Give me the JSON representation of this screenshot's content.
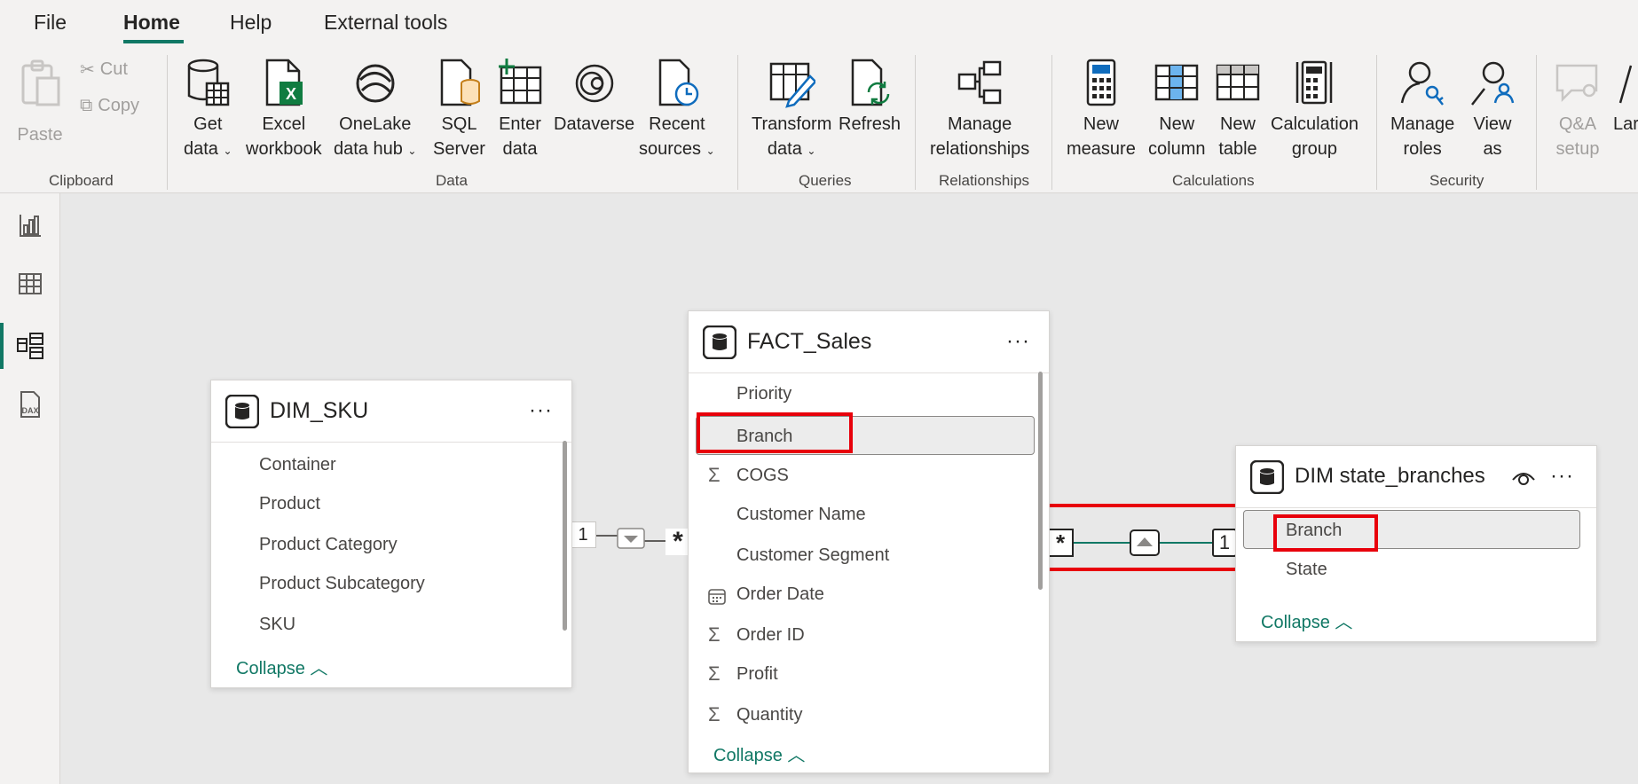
{
  "menu": {
    "tabs": [
      "File",
      "Home",
      "Help",
      "External tools"
    ],
    "active": "Home"
  },
  "ribbon": {
    "clipboard": {
      "paste": "Paste",
      "cut": "Cut",
      "copy": "Copy",
      "group": "Clipboard"
    },
    "data": {
      "get_data": [
        "Get",
        "data"
      ],
      "excel": [
        "Excel",
        "workbook"
      ],
      "onelake": [
        "OneLake",
        "data hub"
      ],
      "sql": [
        "SQL",
        "Server"
      ],
      "enter": [
        "Enter",
        "data"
      ],
      "dataverse": [
        "Dataverse"
      ],
      "recent": [
        "Recent",
        "sources"
      ],
      "group": "Data"
    },
    "queries": {
      "transform": [
        "Transform",
        "data"
      ],
      "refresh": [
        "Refresh"
      ],
      "group": "Queries"
    },
    "relationships": {
      "manage": [
        "Manage",
        "relationships"
      ],
      "group": "Relationships"
    },
    "calculations": {
      "new_measure": [
        "New",
        "measure"
      ],
      "new_column": [
        "New",
        "column"
      ],
      "new_table": [
        "New",
        "table"
      ],
      "calc_group": [
        "Calculation",
        "group"
      ],
      "group": "Calculations"
    },
    "security": {
      "manage_roles": [
        "Manage",
        "roles"
      ],
      "view_as": [
        "View",
        "as"
      ],
      "group": "Security"
    },
    "qa": {
      "qa_setup": [
        "Q&A",
        "setup"
      ],
      "lang": "Lar"
    }
  },
  "nav": {
    "items": [
      "report-view",
      "table-view",
      "model-view",
      "dax-query-view"
    ],
    "active": "model-view"
  },
  "tables": {
    "dim_sku": {
      "title": "DIM_SKU",
      "fields": [
        "Container",
        "Product",
        "Product Category",
        "Product Subcategory",
        "SKU"
      ],
      "collapse": "Collapse"
    },
    "fact_sales": {
      "title": "FACT_Sales",
      "fields": [
        {
          "name": "Priority",
          "icon": ""
        },
        {
          "name": "Branch",
          "icon": ""
        },
        {
          "name": "COGS",
          "icon": "Σ"
        },
        {
          "name": "Customer Name",
          "icon": ""
        },
        {
          "name": "Customer Segment",
          "icon": ""
        },
        {
          "name": "Order Date",
          "icon": "calendar"
        },
        {
          "name": "Order ID",
          "icon": "Σ"
        },
        {
          "name": "Profit",
          "icon": "Σ"
        },
        {
          "name": "Quantity",
          "icon": "Σ"
        }
      ],
      "collapse": "Collapse"
    },
    "dim_state": {
      "title": "DIM state_branches",
      "fields": [
        "Branch",
        "State"
      ],
      "collapse": "Collapse"
    }
  },
  "relationships": {
    "sku_sales": {
      "one": "1",
      "many": "*"
    },
    "sales_state": {
      "many": "*",
      "one": "1"
    }
  },
  "colors": {
    "accent": "#117865",
    "highlight": "#e8000b"
  }
}
